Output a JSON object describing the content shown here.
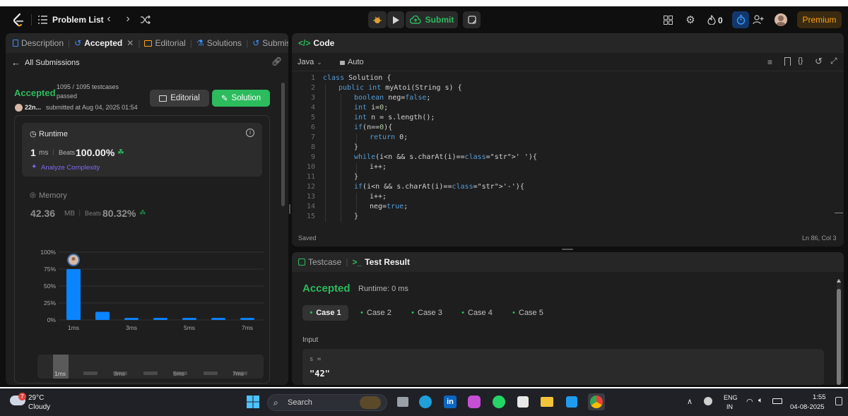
{
  "topbar": {
    "problem_list": "Problem List",
    "submit": "Submit",
    "streak": "0",
    "premium": "Premium"
  },
  "left_panel": {
    "tabs": [
      "Description",
      "Accepted",
      "Editorial",
      "Solutions",
      "Submissi"
    ],
    "all_submissions": "All Submissions",
    "status": "Accepted",
    "testcases": "1095 / 1095 testcases",
    "passed": "passed",
    "user": "22n...",
    "submitted_at": "submitted at Aug 04, 2025 01:54",
    "editorial_btn": "Editorial",
    "solution_btn": "Solution",
    "runtime": {
      "title": "Runtime",
      "value": "1",
      "unit": "ms",
      "beats_label": "Beats",
      "beats_value": "100.00%",
      "analyze": "Analyze Complexity"
    },
    "memory": {
      "title": "Memory",
      "value": "42.36",
      "unit": "MB",
      "beats_label": "Beats",
      "beats_value": "80.32%"
    }
  },
  "chart_data": {
    "type": "bar",
    "y_tick_labels": [
      "100%",
      "75%",
      "50%",
      "25%",
      "0%"
    ],
    "x_tick_labels": [
      "1ms",
      "3ms",
      "5ms",
      "7ms"
    ],
    "ylim": [
      0,
      100
    ],
    "values": [
      75,
      12,
      3,
      3,
      3,
      3,
      3
    ],
    "highlight_index": 0,
    "accent": "#0a84ff"
  },
  "mini_chart": {
    "labels": [
      "1ms",
      "3ms",
      "5ms",
      "7ms"
    ]
  },
  "code_panel": {
    "title": "Code",
    "language": "Java",
    "auto": "Auto",
    "saved": "Saved",
    "position": "Ln 86, Col 3",
    "lines": [
      {
        "n": "1",
        "indent": 0,
        "html": "class Solution {"
      },
      {
        "n": "2",
        "indent": 1,
        "html": "public int myAtoi(String s) {"
      },
      {
        "n": "3",
        "indent": 2,
        "html": "boolean neg=false;"
      },
      {
        "n": "4",
        "indent": 2,
        "html": "int i=0;"
      },
      {
        "n": "5",
        "indent": 2,
        "html": "int n = s.length();"
      },
      {
        "n": "6",
        "indent": 2,
        "html": "if(n==0){"
      },
      {
        "n": "7",
        "indent": 3,
        "html": "return 0;"
      },
      {
        "n": "8",
        "indent": 2,
        "html": "}"
      },
      {
        "n": "9",
        "indent": 2,
        "html": "while(i<n && s.charAt(i)==' '){"
      },
      {
        "n": "10",
        "indent": 3,
        "html": "i++;"
      },
      {
        "n": "11",
        "indent": 2,
        "html": "}"
      },
      {
        "n": "12",
        "indent": 2,
        "html": "if(i<n && s.charAt(i)=='-'){"
      },
      {
        "n": "13",
        "indent": 3,
        "html": "i++;"
      },
      {
        "n": "14",
        "indent": 3,
        "html": "neg=true;"
      },
      {
        "n": "15",
        "indent": 2,
        "html": "}"
      }
    ]
  },
  "test_panel": {
    "testcase_tab": "Testcase",
    "result_tab": "Test Result",
    "status": "Accepted",
    "runtime": "Runtime: 0 ms",
    "cases": [
      "Case 1",
      "Case 2",
      "Case 3",
      "Case 4",
      "Case 5"
    ],
    "input_label": "Input",
    "var_name": "s =",
    "var_value": "\"42\""
  },
  "taskbar": {
    "weather_temp": "29°C",
    "weather_desc": "Cloudy",
    "weather_badge": "7",
    "search": "Search",
    "lang": "ENG",
    "region": "IN",
    "time": "1:55",
    "date": "04-08-2025"
  },
  "colors": {
    "accepted": "#2cbb5d",
    "accent": "#0a84ff",
    "premium": "#ffa116"
  }
}
